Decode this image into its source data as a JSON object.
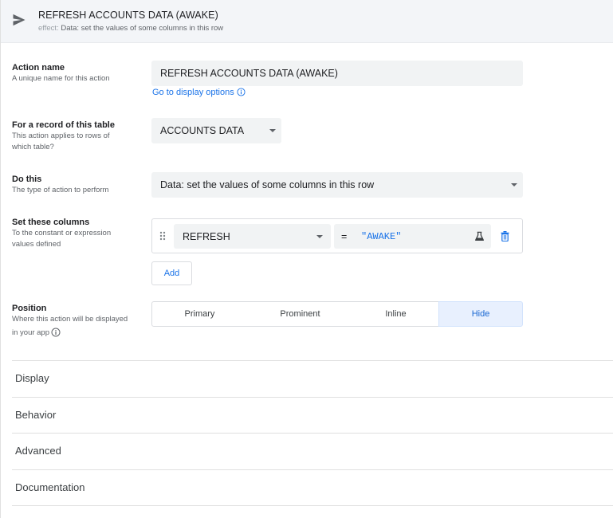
{
  "header": {
    "title": "REFRESH ACCOUNTS DATA (AWAKE)",
    "subtitle_prefix": "effect:",
    "subtitle_text": "Data: set the values of some columns in this row",
    "icon": "send-icon"
  },
  "action_name": {
    "label": "Action name",
    "desc": "A unique name for this action",
    "value": "REFRESH ACCOUNTS DATA (AWAKE)",
    "link": "Go to display options"
  },
  "table": {
    "label": "For a record of this table",
    "desc_line1": "This action applies to rows of",
    "desc_line2": "which table?",
    "value": "ACCOUNTS DATA"
  },
  "do_this": {
    "label": "Do this",
    "desc": "The type of action to perform",
    "value": "Data: set the values of some columns in this row"
  },
  "set_columns": {
    "label": "Set these columns",
    "desc_line1": "To the constant or expression",
    "desc_line2": "values defined",
    "column": "REFRESH",
    "operator": "=",
    "expression": "\"AWAKE\"",
    "add_label": "Add"
  },
  "position": {
    "label": "Position",
    "desc_line1": "Where this action will be displayed",
    "desc_line2": "in your app",
    "options": [
      "Primary",
      "Prominent",
      "Inline",
      "Hide"
    ],
    "selected": "Hide"
  },
  "sections": [
    "Display",
    "Behavior",
    "Advanced",
    "Documentation"
  ],
  "colors": {
    "accent": "#1a73e8",
    "header_bg": "#f3f5f8",
    "field_bg": "#f1f3f4",
    "selected_bg": "#e8f0fe"
  }
}
